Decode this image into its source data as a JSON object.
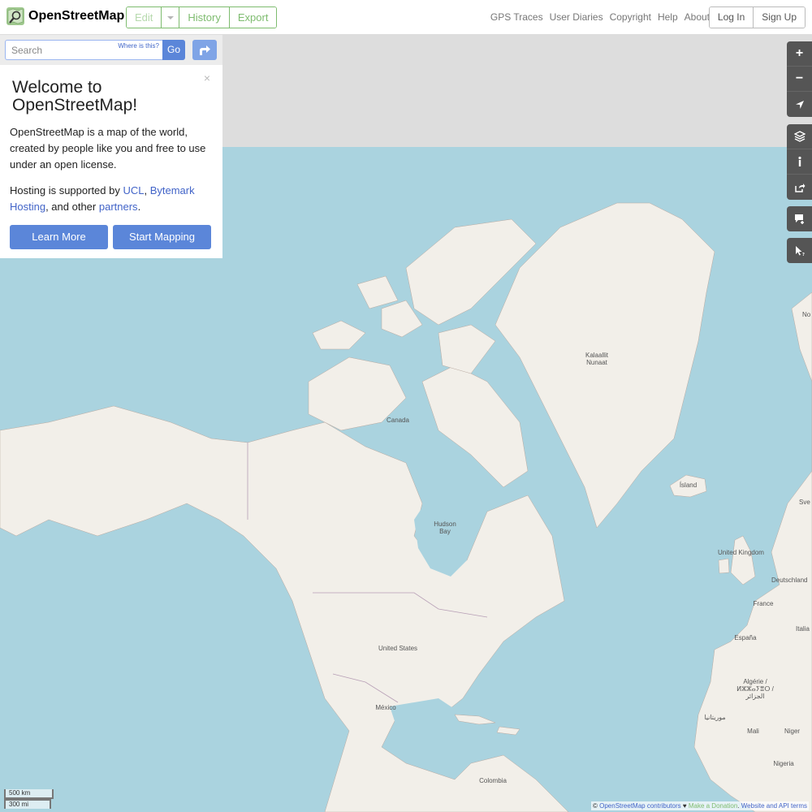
{
  "header": {
    "logo_text": "OpenStreetMap",
    "edit_label": "Edit",
    "history_label": "History",
    "export_label": "Export",
    "nav": [
      "GPS Traces",
      "User Diaries",
      "Copyright",
      "Help",
      "About"
    ],
    "login_label": "Log In",
    "signup_label": "Sign Up"
  },
  "search": {
    "placeholder": "Search",
    "where_label": "Where is this?",
    "go_label": "Go"
  },
  "welcome": {
    "title": "Welcome to OpenStreetMap!",
    "close": "×",
    "intro": "OpenStreetMap is a map of the world, created by people like you and free to use under an open license.",
    "hosting_prefix": "Hosting is supported by ",
    "ucl": "UCL",
    "comma": ", ",
    "bytemark": "Bytemark Hosting",
    "and_other": ", and other ",
    "partners": "partners",
    "period": ".",
    "learn_more": "Learn More",
    "start_mapping": "Start Mapping"
  },
  "map": {
    "labels": [
      "Kalaallit Nunaat",
      "Canada",
      "Hudson Bay",
      "Ísland",
      "United Kingdom",
      "Deutschland",
      "France",
      "España",
      "Italia",
      "Algérie / ⵍⵣⵣⴰⵢⴻⵔ / الجزائر",
      "United States",
      "México",
      "Mali",
      "Niger",
      "Nigeria",
      "Colombia",
      "موريتانيا",
      "No",
      "Sve"
    ],
    "land_color": "#f2efe9",
    "water_color": "#aad3df",
    "polar_color": "#dddddd"
  },
  "controls": {
    "zoom_in": "+",
    "zoom_out": "−"
  },
  "scale": {
    "km": "500 km",
    "mi": "300 mi"
  },
  "attribution": {
    "copy": "© ",
    "osm": "OpenStreetMap contributors",
    "heart": " ♥ ",
    "donate": "Make a Donation",
    "sep": ". ",
    "terms": "Website and API terms"
  }
}
